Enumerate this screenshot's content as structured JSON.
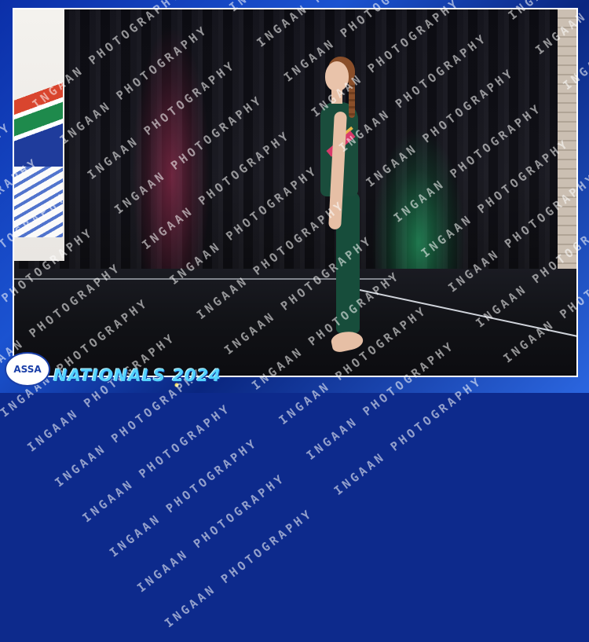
{
  "watermark": {
    "text": "INGAAN PHOTOGRAPHY"
  },
  "branding": {
    "logo_text": "ASSA",
    "event_title": "NATIONALS 2024"
  },
  "colors": {
    "frame_blue": "#0d2a8c",
    "title_cyan": "#55d3ff",
    "leotard_green": "#174d3b",
    "leotard_pink": "#d83a6a"
  }
}
